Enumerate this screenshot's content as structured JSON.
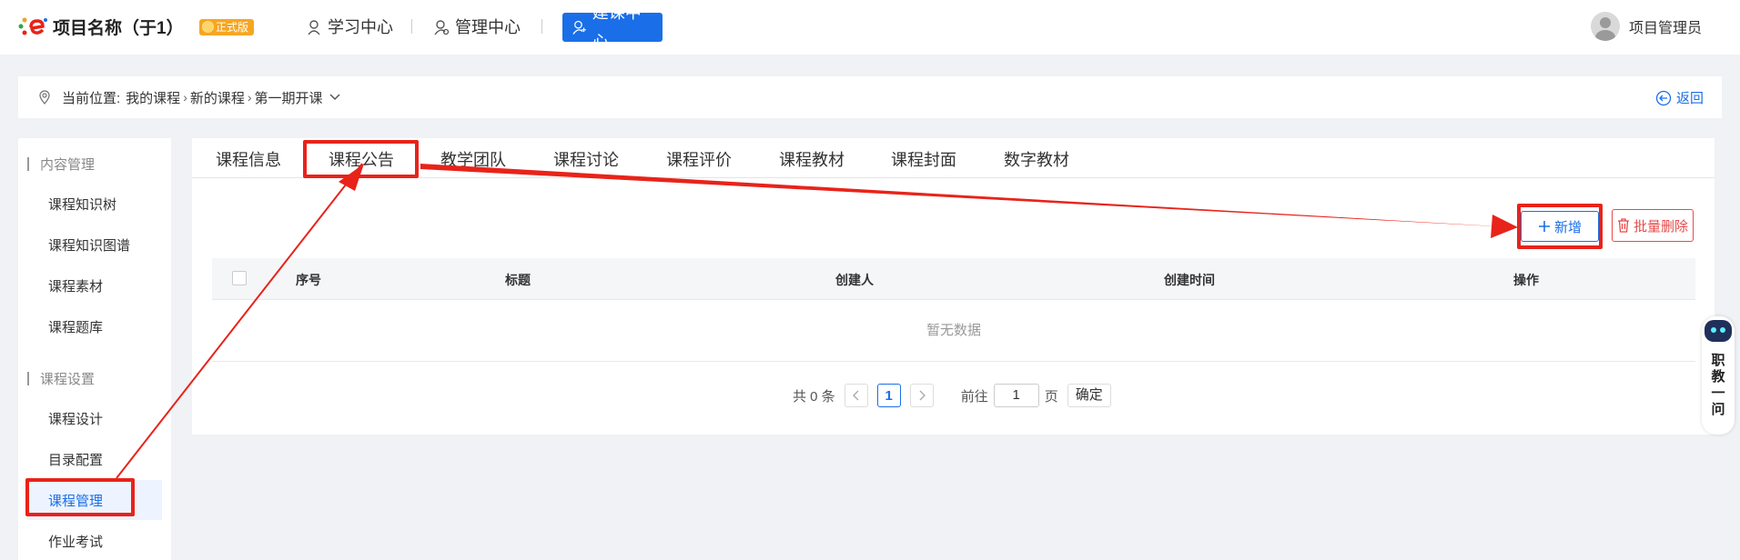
{
  "header": {
    "project_title": "项目名称（于1）",
    "badge": "正式版",
    "nav": [
      "学习中心",
      "管理中心",
      "建课中心"
    ],
    "active_nav": "建课中心",
    "user_name": "项目管理员"
  },
  "breadcrumb": {
    "prefix": "当前位置:",
    "items": [
      "我的课程",
      "新的课程",
      "第一期开课"
    ],
    "back_label": "返回"
  },
  "sidebar": {
    "groups": [
      {
        "title": "内容管理",
        "items": [
          "课程知识树",
          "课程知识图谱",
          "课程素材",
          "课程题库"
        ]
      },
      {
        "title": "课程设置",
        "items": [
          "课程设计",
          "目录配置",
          "课程管理",
          "作业考试"
        ]
      }
    ],
    "active_item": "课程管理"
  },
  "tabs": [
    "课程信息",
    "课程公告",
    "教学团队",
    "课程讨论",
    "课程评价",
    "课程教材",
    "课程封面",
    "数字教材"
  ],
  "toolbar": {
    "add_label": "新增",
    "batch_delete_label": "批量删除"
  },
  "table": {
    "columns": [
      "序号",
      "标题",
      "创建人",
      "创建时间",
      "操作"
    ],
    "empty_text": "暂无数据"
  },
  "pagination": {
    "total_text": "共 0 条",
    "current_page": "1",
    "goto_label": "前往",
    "goto_value": "1",
    "page_unit": "页",
    "confirm_label": "确定"
  },
  "assistant": {
    "label_chars": [
      "职",
      "教",
      "一",
      "问"
    ]
  },
  "colors": {
    "accent": "#1a6fe8",
    "annotation": "#e8231a",
    "danger": "#e84a4a"
  }
}
